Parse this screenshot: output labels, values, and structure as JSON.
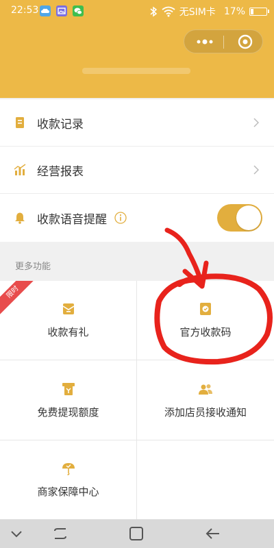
{
  "status_bar": {
    "time": "22:53",
    "carrier": "无SIM卡",
    "battery_percent": "17%",
    "battery_level": 0.17,
    "icons": [
      "app-cloud-icon",
      "gallery-icon",
      "wechat-icon",
      "bluetooth-icon",
      "wifi-icon",
      "battery-icon"
    ]
  },
  "capsule": {
    "icons": [
      "more-dots-icon",
      "close-target-icon"
    ]
  },
  "menu": {
    "items": [
      {
        "label": "收款记录",
        "icon": "receipt-record-icon",
        "has_chevron": true
      },
      {
        "label": "经营报表",
        "icon": "bar-chart-icon",
        "has_chevron": true
      },
      {
        "label": "收款语音提醒",
        "icon": "bell-icon",
        "toggle_on": true
      }
    ]
  },
  "more_functions": {
    "title": "更多功能",
    "ribbon": "限时",
    "items": [
      {
        "label": "收款有礼",
        "icon": "gift-envelope-icon"
      },
      {
        "label": "官方收款码",
        "icon": "qr-code-icon"
      },
      {
        "label": "免费提现额度",
        "icon": "withdraw-icon"
      },
      {
        "label": "添加店员接收通知",
        "icon": "staff-icon"
      },
      {
        "label": "商家保障中心",
        "icon": "umbrella-icon"
      },
      {
        "label": "",
        "icon": ""
      }
    ]
  },
  "navbar": {
    "icons": [
      "collapse-chevron-icon",
      "multitask-icon",
      "home-square-icon",
      "back-arrow-icon"
    ]
  },
  "colors": {
    "header_bg": "#EDB947",
    "accent": "#E2AE3E",
    "annotation": "#E8231C",
    "ribbon": "#E84C4C"
  }
}
